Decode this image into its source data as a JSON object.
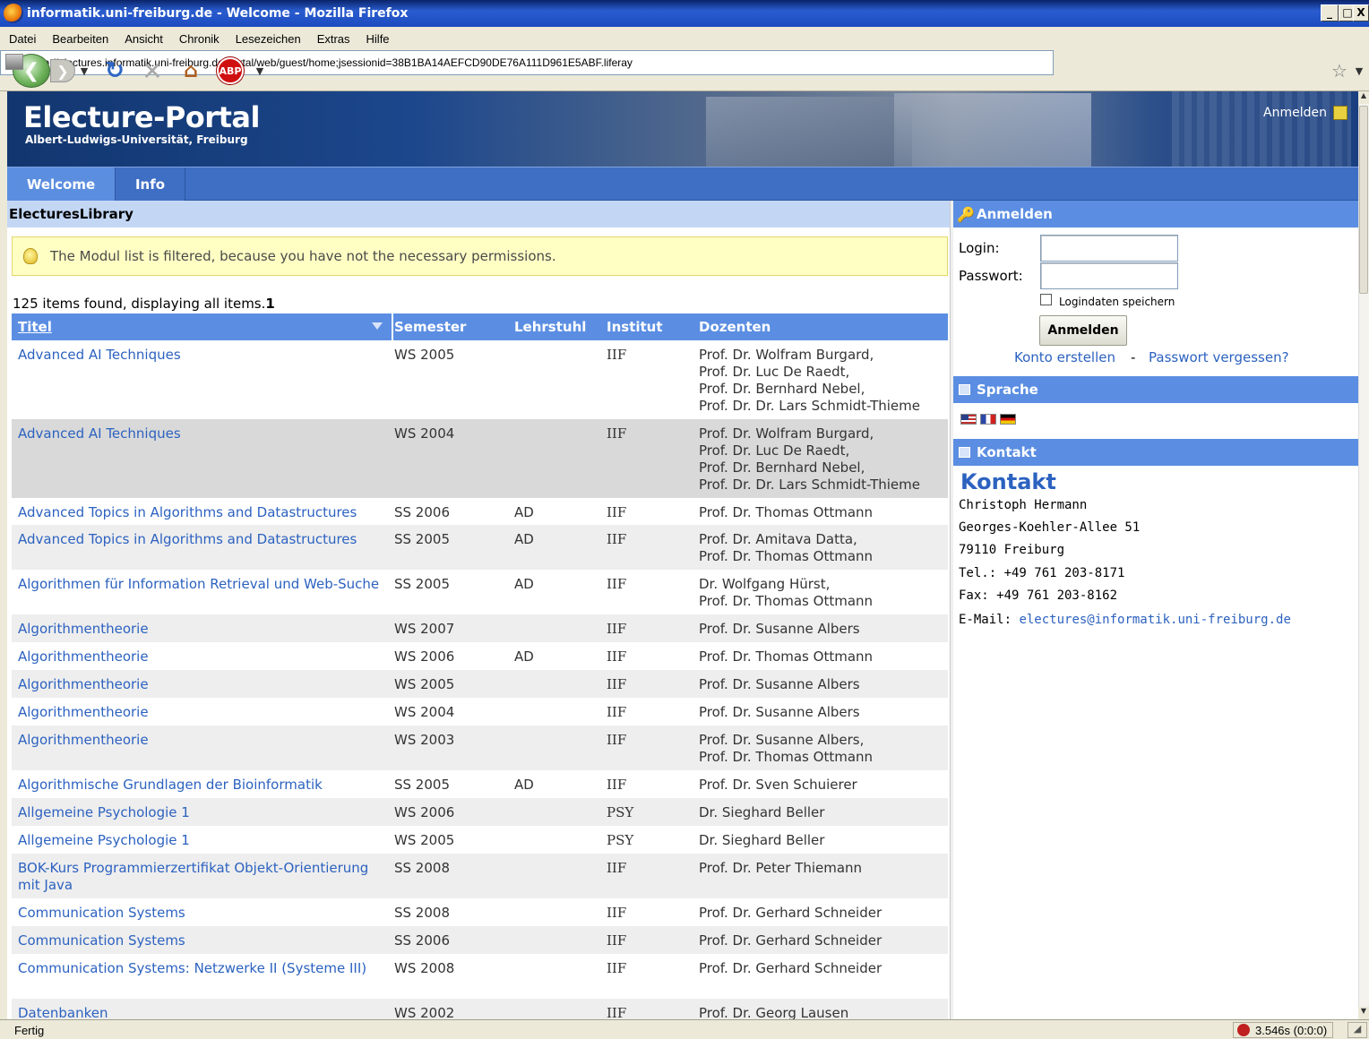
{
  "window": {
    "title": "informatik.uni-freiburg.de - Welcome - Mozilla Firefox",
    "min": "_",
    "max": "□",
    "close": "X"
  },
  "menu": [
    "Datei",
    "Bearbeiten",
    "Ansicht",
    "Chronik",
    "Lesezeichen",
    "Extras",
    "Hilfe"
  ],
  "nav": {
    "url": "http://electures.informatik.uni-freiburg.de/portal/web/guest/home;jsessionid=38B1BA14AEFCD90DE76A111D961E5ABF.liferay",
    "abp": "ABP"
  },
  "banner": {
    "title": "Electure-Portal",
    "subtitle": "Albert-Ludwigs-Universität, Freiburg",
    "login": "Anmelden"
  },
  "tabs": {
    "welcome": "Welcome",
    "info": "Info"
  },
  "library": {
    "header": "ElecturesLibrary",
    "info": "The Modul list is filtered, because you have not the necessary permissions.",
    "found_text": "125 items found, displaying all items.",
    "found_page": "1",
    "columns": {
      "titel": "Titel",
      "semester": "Semester",
      "lehrstuhl": "Lehrstuhl",
      "institut": "Institut",
      "dozenten": "Dozenten"
    },
    "rows": [
      {
        "title": "Advanced AI Techniques",
        "semester": "WS 2005",
        "lehrstuhl": "",
        "institut": "IIF",
        "dozenten": "Prof. Dr. Wolfram Burgard,\nProf. Dr. Luc De Raedt,\nProf. Dr. Bernhard Nebel,\nProf. Dr. Dr. Lars Schmidt-Thieme"
      },
      {
        "title": "Advanced AI Techniques",
        "semester": "WS 2004",
        "lehrstuhl": "",
        "institut": "IIF",
        "dozenten": "Prof. Dr. Wolfram Burgard,\nProf. Dr. Luc De Raedt,\nProf. Dr. Bernhard Nebel,\nProf. Dr. Dr. Lars Schmidt-Thieme"
      },
      {
        "title": "Advanced Topics in Algorithms and Datastructures",
        "semester": "SS 2006",
        "lehrstuhl": "AD",
        "institut": "IIF",
        "dozenten": "Prof. Dr. Thomas Ottmann"
      },
      {
        "title": "Advanced Topics in Algorithms and Datastructures",
        "semester": "SS 2005",
        "lehrstuhl": "AD",
        "institut": "IIF",
        "dozenten": "Prof. Dr. Amitava Datta,\nProf. Dr. Thomas Ottmann"
      },
      {
        "title": "Algorithmen für Information Retrieval und Web-Suche",
        "semester": "SS 2005",
        "lehrstuhl": "AD",
        "institut": "IIF",
        "dozenten": "Dr. Wolfgang Hürst,\nProf. Dr. Thomas Ottmann"
      },
      {
        "title": "Algorithmentheorie",
        "semester": "WS 2007",
        "lehrstuhl": "",
        "institut": "IIF",
        "dozenten": "Prof. Dr. Susanne Albers"
      },
      {
        "title": "Algorithmentheorie",
        "semester": "WS 2006",
        "lehrstuhl": "AD",
        "institut": "IIF",
        "dozenten": "Prof. Dr. Thomas Ottmann"
      },
      {
        "title": "Algorithmentheorie",
        "semester": "WS 2005",
        "lehrstuhl": "",
        "institut": "IIF",
        "dozenten": "Prof. Dr. Susanne Albers"
      },
      {
        "title": "Algorithmentheorie",
        "semester": "WS 2004",
        "lehrstuhl": "",
        "institut": "IIF",
        "dozenten": "Prof. Dr. Susanne Albers"
      },
      {
        "title": "Algorithmentheorie",
        "semester": "WS 2003",
        "lehrstuhl": "",
        "institut": "IIF",
        "dozenten": "Prof. Dr. Susanne Albers,\nProf. Dr. Thomas Ottmann"
      },
      {
        "title": "Algorithmische Grundlagen der Bioinformatik",
        "semester": "SS 2005",
        "lehrstuhl": "AD",
        "institut": "IIF",
        "dozenten": "Prof. Dr. Sven Schuierer"
      },
      {
        "title": "Allgemeine Psychologie 1",
        "semester": "WS 2006",
        "lehrstuhl": "",
        "institut": "PSY",
        "dozenten": "Dr. Sieghard Beller"
      },
      {
        "title": "Allgemeine Psychologie 1",
        "semester": "WS 2005",
        "lehrstuhl": "",
        "institut": "PSY",
        "dozenten": "Dr. Sieghard Beller"
      },
      {
        "title": "BOK-Kurs Programmierzertifikat Objekt-Orientierung mit Java",
        "semester": "SS 2008",
        "lehrstuhl": "",
        "institut": "IIF",
        "dozenten": "Prof. Dr. Peter Thiemann"
      },
      {
        "title": "Communication Systems",
        "semester": "SS 2008",
        "lehrstuhl": "",
        "institut": "IIF",
        "dozenten": "Prof. Dr. Gerhard Schneider"
      },
      {
        "title": "Communication Systems",
        "semester": "SS 2006",
        "lehrstuhl": "",
        "institut": "IIF",
        "dozenten": "Prof. Dr. Gerhard Schneider"
      },
      {
        "title": "Communication Systems: Netzwerke II (Systeme III)",
        "semester": "WS 2008",
        "lehrstuhl": "",
        "institut": "IIF",
        "dozenten": "Prof. Dr. Gerhard Schneider"
      },
      {
        "title": "Datenbanken",
        "semester": "WS 2002",
        "lehrstuhl": "",
        "institut": "IIF",
        "dozenten": "Prof. Dr. Georg Lausen"
      }
    ]
  },
  "login": {
    "header": "Anmelden",
    "login_label": "Login:",
    "password_label": "Passwort:",
    "login_value": "",
    "password_value": "",
    "remember": "Logindaten speichern",
    "submit": "Anmelden",
    "create": "Konto erstellen",
    "separator": "-",
    "forgot": "Passwort vergessen?"
  },
  "sprache": {
    "header": "Sprache"
  },
  "kontakt": {
    "header": "Kontakt",
    "title": "Kontakt",
    "name": "Christoph Hermann",
    "street": "Georges-Koehler-Allee 51",
    "city": "79110 Freiburg",
    "tel": "Tel.: +49 761 203-8171",
    "fax": "Fax: +49 761 203-8162",
    "email_label": "E-Mail: ",
    "email": "electures@informatik.uni-freiburg.de"
  },
  "status": {
    "text": "Fertig",
    "timer": "3.546s (0:0:0)"
  }
}
